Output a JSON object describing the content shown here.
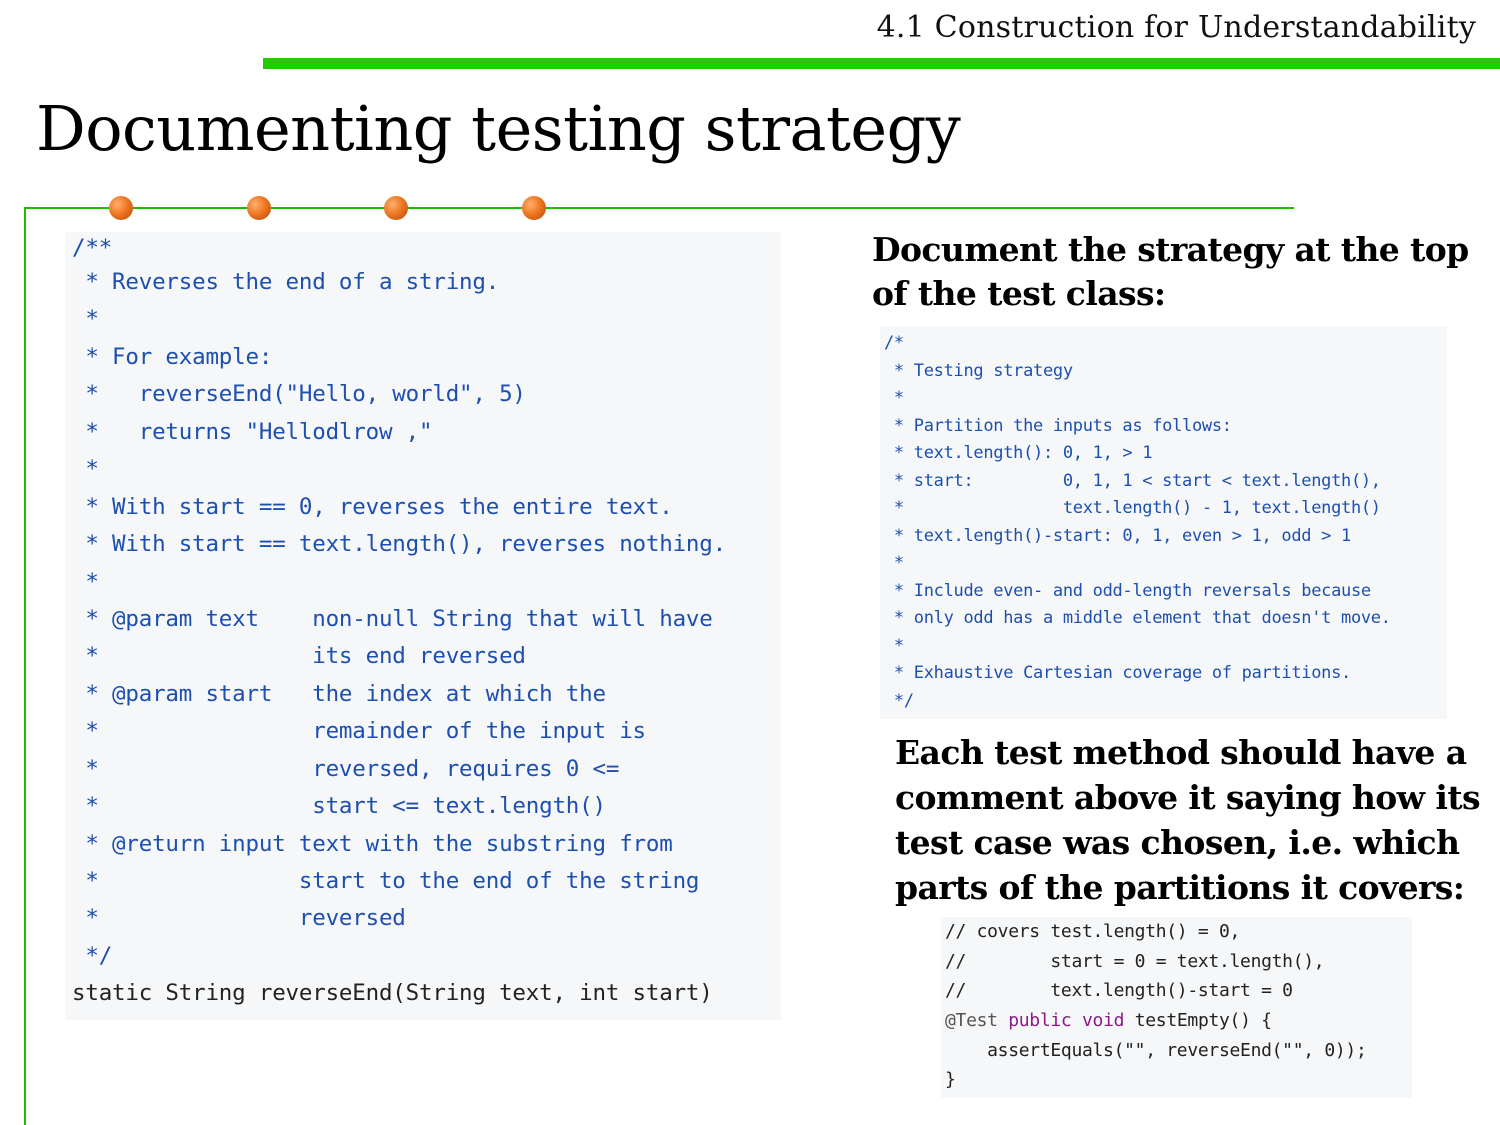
{
  "header": {
    "section_title": "4.1 Construction for Understandability"
  },
  "slide": {
    "title": "Documenting testing strategy"
  },
  "left_code": {
    "lines": [
      "/**",
      " * Reverses the end of a string.",
      " *",
      " * For example:",
      " *   reverseEnd(\"Hello, world\", 5)",
      " *   returns \"Hellodlrow ,\"",
      " *",
      " * With start == 0, reverses the entire text.",
      " * With start == text.length(), reverses nothing.",
      " *",
      " * @param text    non-null String that will have",
      " *                its end reversed",
      " * @param start   the index at which the",
      " *                remainder of the input is",
      " *                reversed, requires 0 <=",
      " *                start <= text.length()",
      " * @return input text with the substring from",
      " *               start to the end of the string",
      " *               reversed",
      " */",
      "static String reverseEnd(String text, int start)"
    ]
  },
  "right": {
    "strategy_heading": "Document the strategy at the top of the test class:",
    "strategy_code": [
      "/*",
      " * Testing strategy",
      " *",
      " * Partition the inputs as follows:",
      " * text.length(): 0, 1, > 1",
      " * start:         0, 1, 1 < start < text.length(),",
      " *                text.length() - 1, text.length()",
      " * text.length()-start: 0, 1, even > 1, odd > 1",
      " *",
      " * Include even- and odd-length reversals because",
      " * only odd has a middle element that doesn't move.",
      " *",
      " * Exhaustive Cartesian coverage of partitions.",
      " */"
    ],
    "method_heading": "Each test method should have a comment above it saying how its test case was chosen, i.e. which parts of the partitions it covers:",
    "test_code": {
      "comment1": "// covers test.length() = 0,",
      "comment2": "//        start = 0 = text.length(),",
      "comment3": "//        text.length()-start = 0",
      "annotation": "@Test",
      "kw_public": "public",
      "kw_void": "void",
      "method_sig": "testEmpty() {",
      "body": "    assertEquals(\"\", reverseEnd(\"\", 0));",
      "close": "}"
    }
  },
  "colors": {
    "accent_green": "#22cc00",
    "bullet_orange": "#ee7722",
    "code_comment_blue": "#1c4fb0",
    "code_keyword_purple": "#8a1a8a",
    "code_background": "#f6f7f8"
  }
}
